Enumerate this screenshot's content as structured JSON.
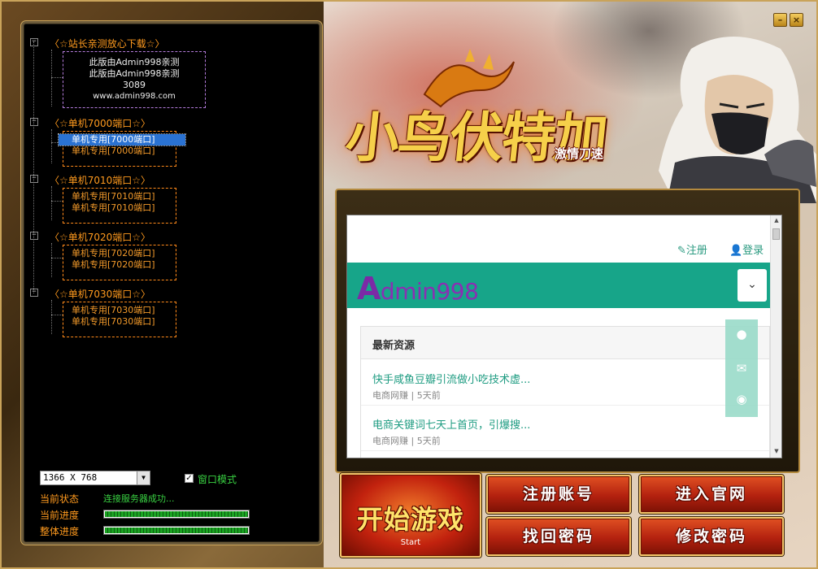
{
  "window": {
    "min_label": "–",
    "close_label": "×"
  },
  "banner": {
    "title": "小鸟伏特加",
    "subtitle": "激情刀速"
  },
  "tree": {
    "groups": [
      {
        "label": "〈☆站长亲测放心下载☆〉",
        "entries": [
          "此版由Admin998亲测",
          "此版由Admin998亲测",
          "3089",
          "www.admin998.com"
        ]
      },
      {
        "label": "〈☆单机7000端口☆〉",
        "entries": [
          "单机专用[7000端口]",
          "单机专用[7000端口]"
        ]
      },
      {
        "label": "〈☆单机7010端口☆〉",
        "entries": [
          "单机专用[7010端口]",
          "单机专用[7010端口]"
        ]
      },
      {
        "label": "〈☆单机7020端口☆〉",
        "entries": [
          "单机专用[7020端口]",
          "单机专用[7020端口]"
        ]
      },
      {
        "label": "〈☆单机7030端口☆〉",
        "entries": [
          "单机专用[7030端口]",
          "单机专用[7030端口]"
        ]
      }
    ],
    "expander": "−"
  },
  "settings": {
    "resolution": "1366 X 768",
    "window_mode_label": "窗口模式",
    "window_mode_checked": "✓"
  },
  "status": {
    "current_state_label": "当前状态",
    "current_state_value": "连接服务器成功...",
    "current_progress_label": "当前进度",
    "current_progress": 1.0,
    "overall_progress_label": "整体进度",
    "overall_progress": 1.0
  },
  "browser": {
    "register_link": "✎注册",
    "login_link": "👤登录",
    "logo_a": "A",
    "logo_rest": "dmin998",
    "menu_icon": "⌄",
    "section_title": "最新资源",
    "items": [
      {
        "title": "快手咸鱼豆瓣引流做小吃技术虚...",
        "meta": "电商网赚 | 5天前"
      },
      {
        "title": "电商关键词七天上首页，引爆搜...",
        "meta": "电商网赚 | 5天前"
      }
    ]
  },
  "buttons": {
    "start": "开始游戏",
    "start_sub": "Start",
    "register": "注册账号",
    "website": "进入官网",
    "recover": "找回密码",
    "change_password": "修改密码"
  },
  "colors": {
    "tree_group": "#ff9a1e",
    "status_green": "#39d142",
    "site_bar": "#17a589",
    "button_red": "#c2220e"
  }
}
